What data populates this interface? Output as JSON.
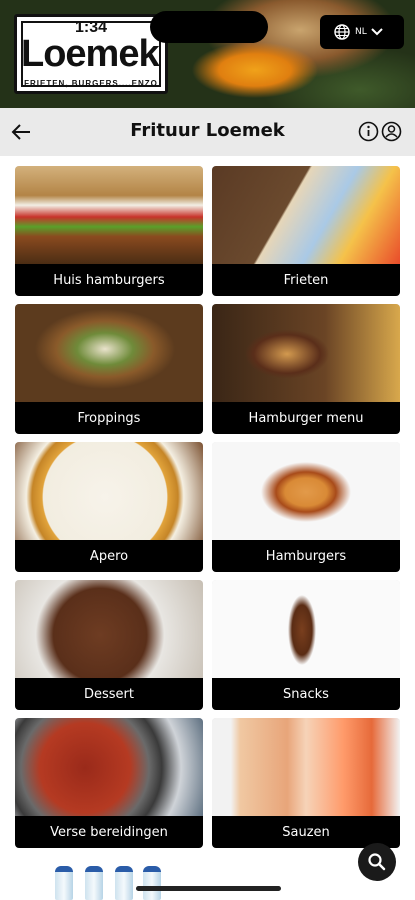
{
  "status_bar": {
    "time": "1:34"
  },
  "hero": {
    "logo_name": "Loemek",
    "logo_tagline": "FRIETEN, BURGERS....ENZO"
  },
  "language": {
    "code": "NL",
    "icon": "globe-icon",
    "chevron": "chevron-down-icon"
  },
  "header": {
    "title": "Frituur Loemek",
    "back_icon": "arrow-left-icon",
    "info_icon": "info-icon",
    "user_icon": "user-icon"
  },
  "categories": [
    {
      "label": "Huis hamburgers"
    },
    {
      "label": "Frieten"
    },
    {
      "label": "Froppings"
    },
    {
      "label": "Hamburger menu"
    },
    {
      "label": "Apero"
    },
    {
      "label": "Hamburgers"
    },
    {
      "label": "Dessert"
    },
    {
      "label": "Snacks"
    },
    {
      "label": "Verse bereidingen"
    },
    {
      "label": "Sauzen"
    }
  ],
  "fab": {
    "icon": "search-icon"
  },
  "colors": {
    "label_bg": "#000000",
    "header_bg": "#eaeaea",
    "text": "#111111"
  }
}
